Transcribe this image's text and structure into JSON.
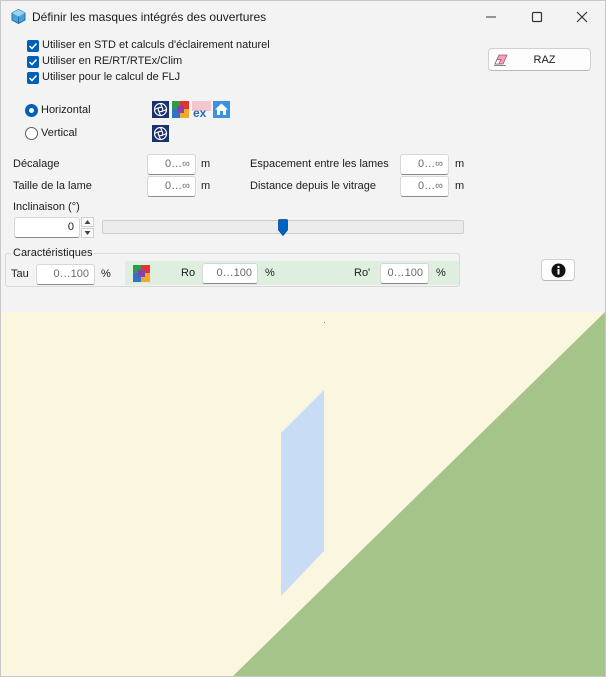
{
  "window": {
    "title": "Définir les masques intégrés des ouvertures"
  },
  "options": {
    "std_label": "Utiliser en STD et calculs d'éclairement naturel",
    "re_label": "Utiliser en RE/RT/RTEx/Clim",
    "flj_label": "Utiliser pour le calcul de FLJ"
  },
  "reset_button": {
    "label": "RAZ"
  },
  "orientation": {
    "horizontal_label": "Horizontal",
    "vertical_label": "Vertical",
    "selected": "Horizontal"
  },
  "fields": {
    "decalage": {
      "label": "Décalage",
      "placeholder": "0…∞",
      "unit": "m"
    },
    "taille": {
      "label": "Taille de la lame",
      "placeholder": "0…∞",
      "unit": "m"
    },
    "espacement": {
      "label": "Espacement entre les lames",
      "placeholder": "0…∞",
      "unit": "m"
    },
    "distance": {
      "label": "Distance depuis le vitrage",
      "placeholder": "0…∞",
      "unit": "m"
    }
  },
  "inclinaison": {
    "label": "Inclinaison (°)",
    "value": "0",
    "slider_fraction": 0.5
  },
  "caracteristiques": {
    "title": "Caractéristiques",
    "tau": {
      "label": "Tau",
      "placeholder": "0…100",
      "unit": "%"
    },
    "ro": {
      "label": "Ro",
      "placeholder": "0…100",
      "unit": "%"
    },
    "ro_prime": {
      "label": "Ro'",
      "placeholder": "0…100",
      "unit": "%"
    }
  },
  "icons": [
    "app-icon",
    "minimize-icon",
    "maximize-icon",
    "close-icon",
    "eraser-icon",
    "aperture-icon",
    "color-palette-icon",
    "ex-icon",
    "home-icon",
    "info-icon"
  ],
  "colors": {
    "accent": "#005fb8",
    "preview_sky": "#faf6df",
    "preview_ground": "#a5c489",
    "preview_window": "#c9dcf6",
    "green_panel": "#dfefdf"
  }
}
